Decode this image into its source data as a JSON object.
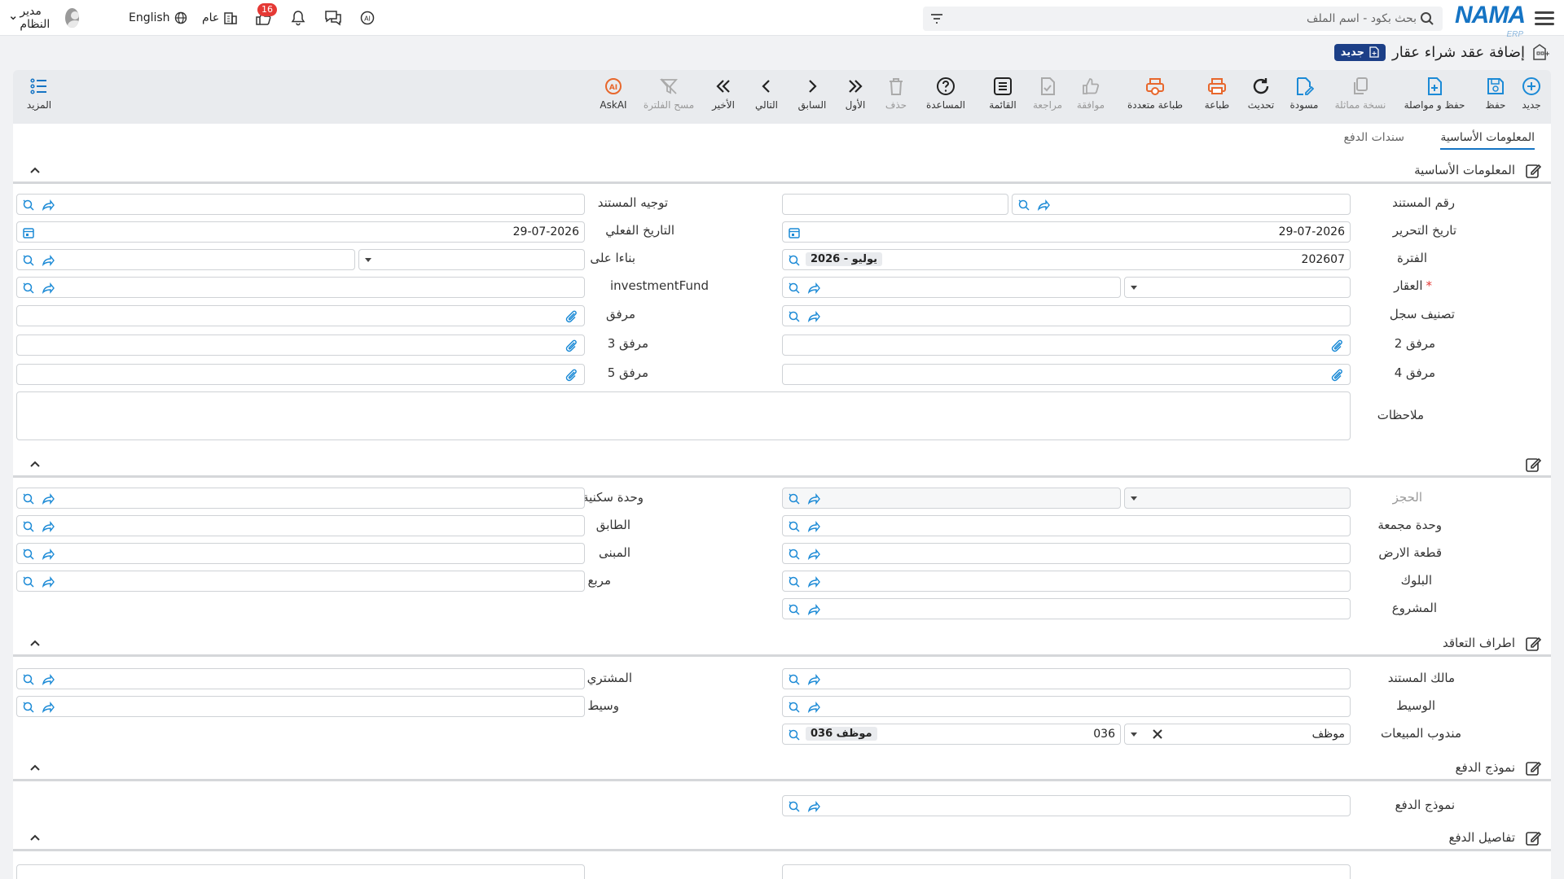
{
  "topbar": {
    "logo_text": "NAMA",
    "logo_sub": "ERP",
    "search_placeholder": "بحث بكود - اسم الملف",
    "notif_count": "16",
    "scope_label": "عام",
    "language_label": "English",
    "user_name": "مدير النظام"
  },
  "header": {
    "title": "إضافة عقد شراء عقار",
    "new_badge": "جديد"
  },
  "toolbar": {
    "new": "جديد",
    "save": "حفظ",
    "save_continue": "حفظ و مواصلة",
    "similar_copy": "نسخة مماثلة",
    "draft": "مسودة",
    "refresh": "تحديث",
    "print": "طباعة",
    "multi_print": "طباعة متعددة",
    "approve": "موافقة",
    "review": "مراجعة",
    "list": "القائمة",
    "help": "المساعدة",
    "delete": "حذف",
    "first": "الأول",
    "previous": "السابق",
    "next": "التالي",
    "last": "الأخير",
    "clear_filter": "مسح الفلترة",
    "askai": "AskAI",
    "more": "المزيد"
  },
  "tabs": {
    "basic": "المعلومات الأساسية",
    "payment_vouchers": "سندات الدفع"
  },
  "sections": {
    "basic": "المعلومات الأساسية",
    "parties": "اطراف التعاقد",
    "payment_model": "نموذج الدفع",
    "payment_details": "تفاصيل الدفع"
  },
  "fields": {
    "doc_number": "رقم المستند",
    "doc_direction": "توجيه المستند",
    "issue_date": "تاريخ التحرير",
    "issue_date_value": "29-07-2026",
    "actual_date": "التاريخ الفعلي",
    "actual_date_value": "29-07-2026",
    "period": "الفترة",
    "period_value": "202607",
    "period_chip": "2026 - يوليو",
    "based_on": "بناءا على",
    "property": "العقار",
    "investment_fund": "investmentFund",
    "record_class": "تصنيف سجل",
    "attachment": "مرفق",
    "attachment2": "مرفق 2",
    "attachment3": "مرفق 3",
    "attachment4": "مرفق 4",
    "attachment5": "مرفق 5",
    "notes": "ملاحظات",
    "reservation": "الحجز",
    "residential_unit": "وحدة سكنية",
    "aggregate_unit": "وحدة مجمعة",
    "floor": "الطابق",
    "land_plot": "قطعة الارض",
    "building": "المبنى",
    "block": "البلوك",
    "square": "مربع",
    "project": "المشروع",
    "doc_owner": "مالك المستند",
    "buyer": "المشتري",
    "broker": "الوسيط",
    "agent": "وسيط",
    "sales_rep": "مندوب المبيعات",
    "sales_rep_type": "موظف",
    "sales_rep_code": "036",
    "sales_rep_chip": "موظف 036",
    "payment_model": "نموذج الدفع"
  },
  "colors": {
    "accent": "#1574c4",
    "icon_blue": "#1b8ad6",
    "icon_orange": "#e8672c",
    "title_pill": "#1c3f87",
    "badge_red": "#e53935"
  }
}
